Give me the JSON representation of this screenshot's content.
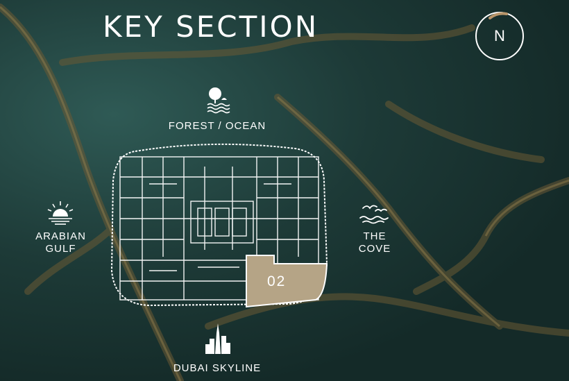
{
  "title": "KEY SECTION",
  "compass": {
    "label": "N",
    "arc_color": "#b8956a"
  },
  "directions": {
    "north": "FOREST / OCEAN",
    "west_line1": "ARABIAN",
    "west_line2": "GULF",
    "east_line1": "THE",
    "east_line2": "COVE",
    "south": "DUBAI SKYLINE"
  },
  "unit": {
    "label": "02",
    "highlight_color": "#b5a486"
  },
  "icons": {
    "north": "tree-waves-icon",
    "west": "sunset-sea-icon",
    "east": "birds-waves-icon",
    "south": "skyline-icon"
  }
}
